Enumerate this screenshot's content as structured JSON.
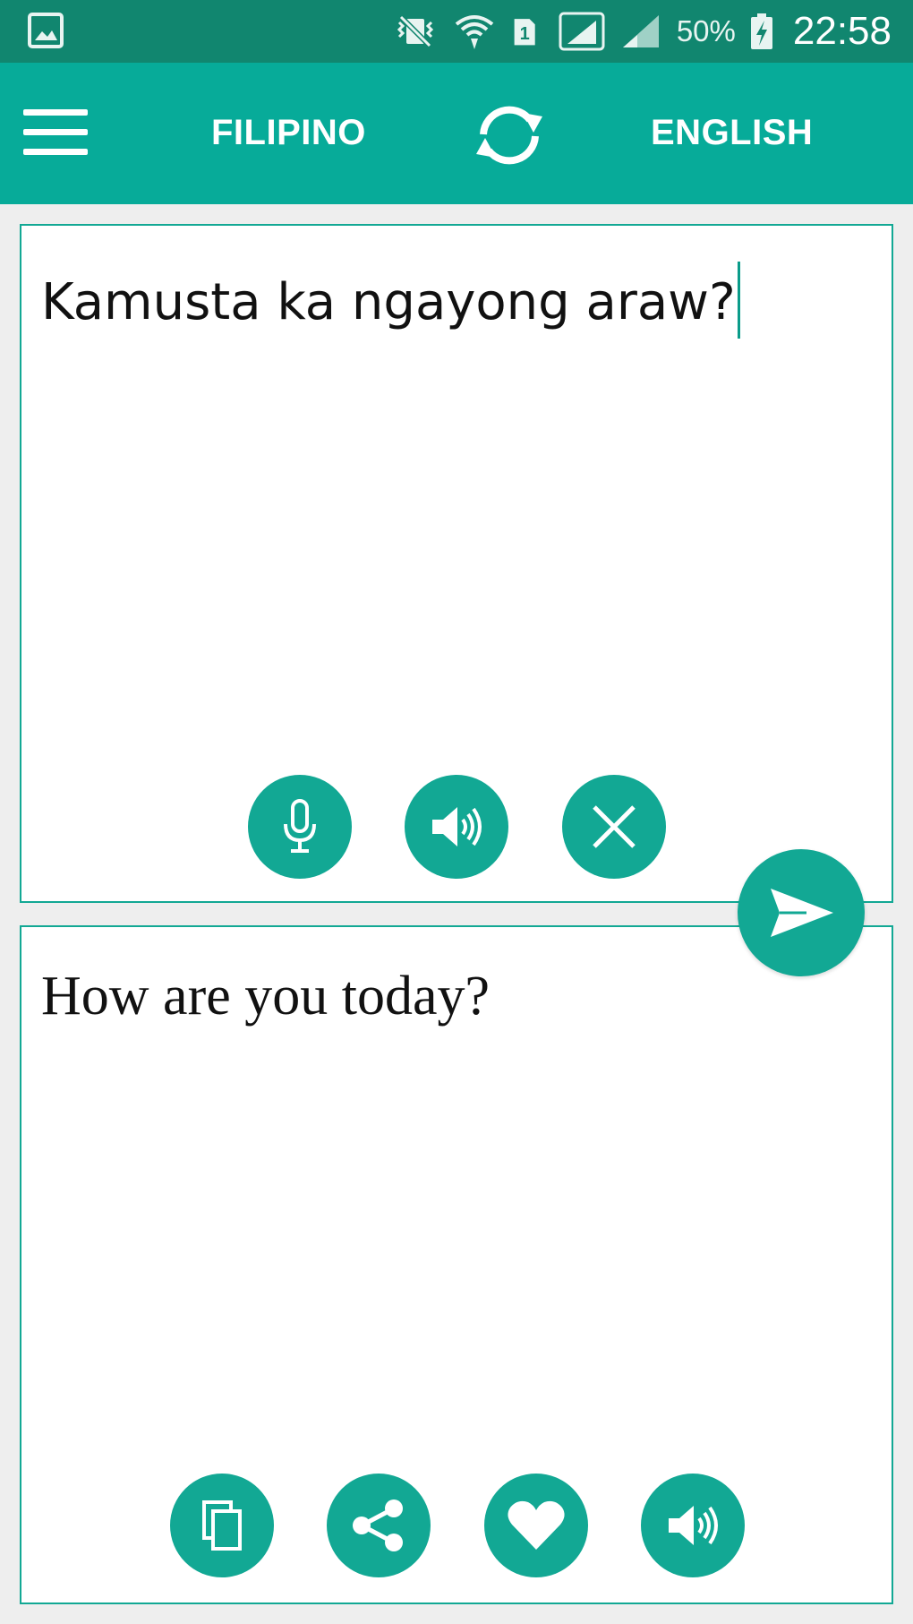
{
  "status_bar": {
    "battery": "50%",
    "time": "22:58",
    "icons": [
      "gallery-icon",
      "vibrate-icon",
      "wifi-icon",
      "sim1-icon",
      "signal-icon",
      "signal-icon",
      "battery-charging-icon"
    ]
  },
  "toolbar": {
    "menu_icon": "hamburger-menu-icon",
    "source_language": "FILIPINO",
    "target_language": "ENGLISH",
    "swap_icon": "swap-refresh-icon"
  },
  "input_panel": {
    "text": "Kamusta ka ngayong araw?",
    "buttons": [
      "microphone-icon",
      "speaker-icon",
      "clear-icon"
    ]
  },
  "translate_button": {
    "icon": "send-icon"
  },
  "output_panel": {
    "text": "How are you today?",
    "buttons": [
      "copy-icon",
      "share-icon",
      "heart-icon",
      "speaker-icon"
    ]
  },
  "colors": {
    "status_bar": "#11866f",
    "toolbar": "#07ab99",
    "accent": "#12a894",
    "background": "#eeeeee"
  }
}
